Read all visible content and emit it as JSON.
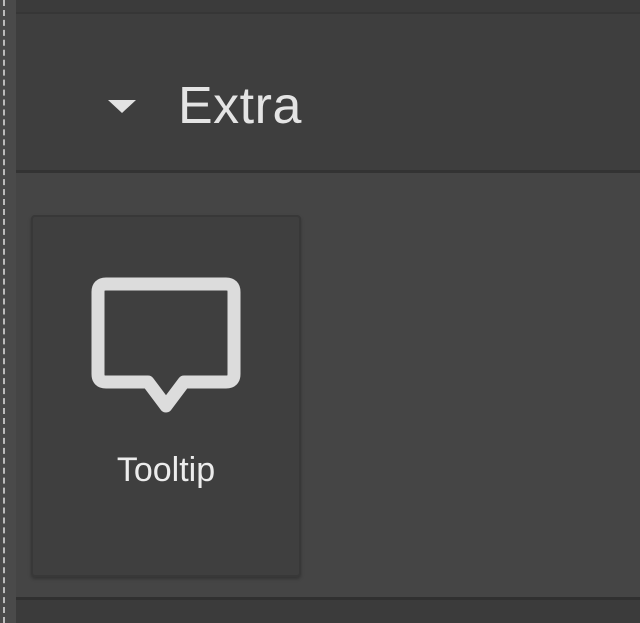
{
  "panel": {
    "section": {
      "title": "Extra",
      "expanded": true,
      "caret_icon": "caret-down-icon"
    },
    "blocks": [
      {
        "label": "Tooltip",
        "icon": "tooltip-icon"
      }
    ]
  },
  "colors": {
    "panel_bg": "#454545",
    "header_bg": "#3e3e3e",
    "card_bg": "#3f3f3f",
    "text": "#e4e4e4",
    "icon": "#dcdcdc"
  }
}
